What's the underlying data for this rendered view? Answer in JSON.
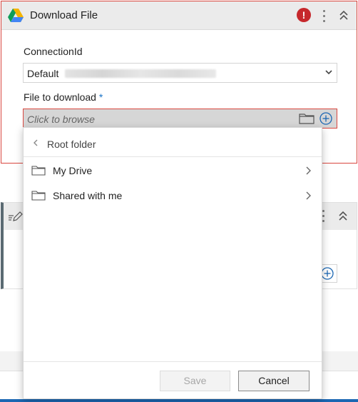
{
  "card1": {
    "title": "Download File",
    "error_icon": "exclamation-circle",
    "error_symbol": "!",
    "connection": {
      "label": "ConnectionId",
      "value": "Default"
    },
    "file": {
      "label": "File to download",
      "required_marker": "*",
      "placeholder": "Click to browse"
    }
  },
  "browser": {
    "back_label": "Root folder",
    "folders": [
      {
        "name": "My Drive"
      },
      {
        "name": "Shared with me"
      }
    ],
    "buttons": {
      "save": "Save",
      "cancel": "Cancel"
    }
  },
  "colors": {
    "error_border": "#d9473f",
    "error_icon": "#c6282c",
    "accent_blue": "#1b67b3"
  }
}
